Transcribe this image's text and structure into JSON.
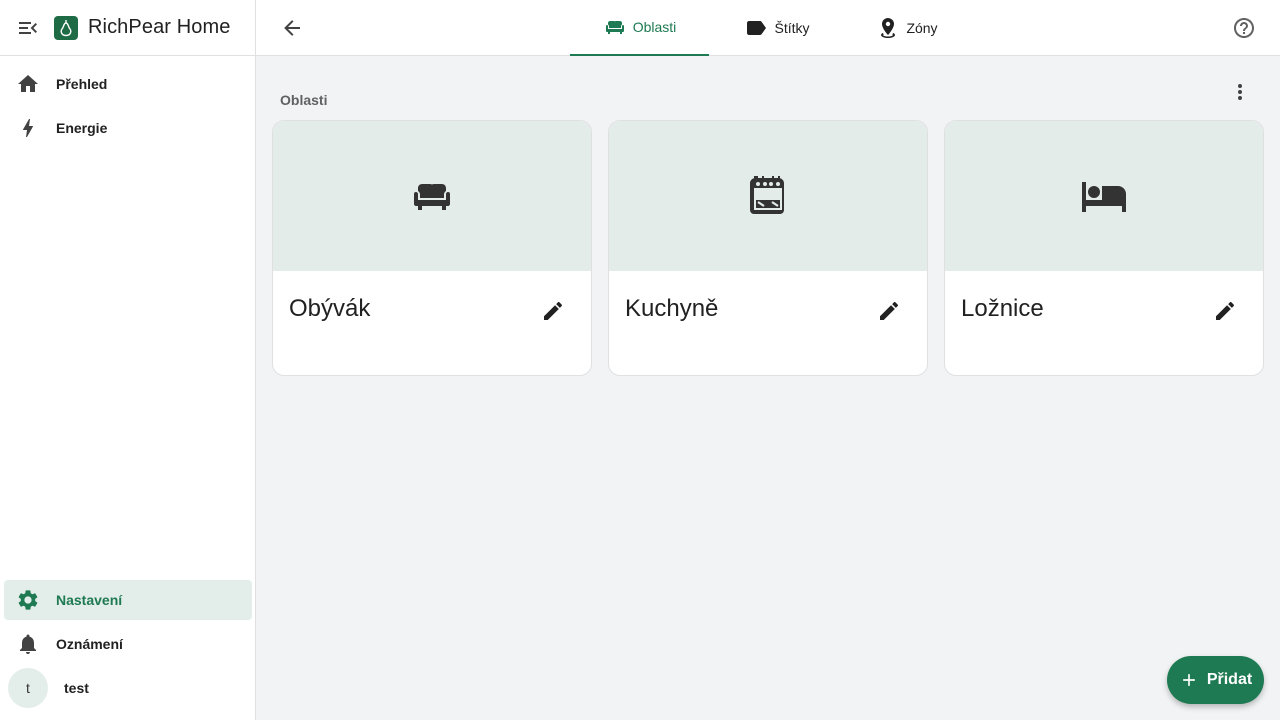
{
  "app": {
    "title": "RichPear Home"
  },
  "colors": {
    "accent": "#1e7a52",
    "card_media": "#e4ece9",
    "active_bg": "#e3ede9",
    "icon": "#333333"
  },
  "sidebar": {
    "menu_icon": "menu-collapse-icon",
    "logo_icon": "pear-logo-icon",
    "top_items": [
      {
        "label": "Přehled",
        "icon": "home-icon"
      },
      {
        "label": "Energie",
        "icon": "lightning-bolt-icon"
      }
    ],
    "bottom_items": [
      {
        "label": "Nastavení",
        "icon": "gear-icon",
        "active": true
      },
      {
        "label": "Oznámení",
        "icon": "bell-icon"
      }
    ],
    "user": {
      "initial": "t",
      "name": "test"
    }
  },
  "topbar": {
    "back_icon": "arrow-left-icon",
    "tabs": [
      {
        "label": "Oblasti",
        "icon": "sofa-icon",
        "active": true
      },
      {
        "label": "Štítky",
        "icon": "label-icon"
      },
      {
        "label": "Zóny",
        "icon": "map-marker-icon"
      }
    ],
    "help_icon": "help-circle-icon"
  },
  "main": {
    "section_title": "Oblasti",
    "menu_icon": "dots-vertical-icon",
    "areas": [
      {
        "name": "Obývák",
        "icon": "sofa-icon"
      },
      {
        "name": "Kuchyně",
        "icon": "stove-icon"
      },
      {
        "name": "Ložnice",
        "icon": "bed-icon"
      }
    ],
    "edit_icon": "pencil-icon"
  },
  "fab": {
    "label": "Přidat",
    "icon": "plus-icon"
  }
}
